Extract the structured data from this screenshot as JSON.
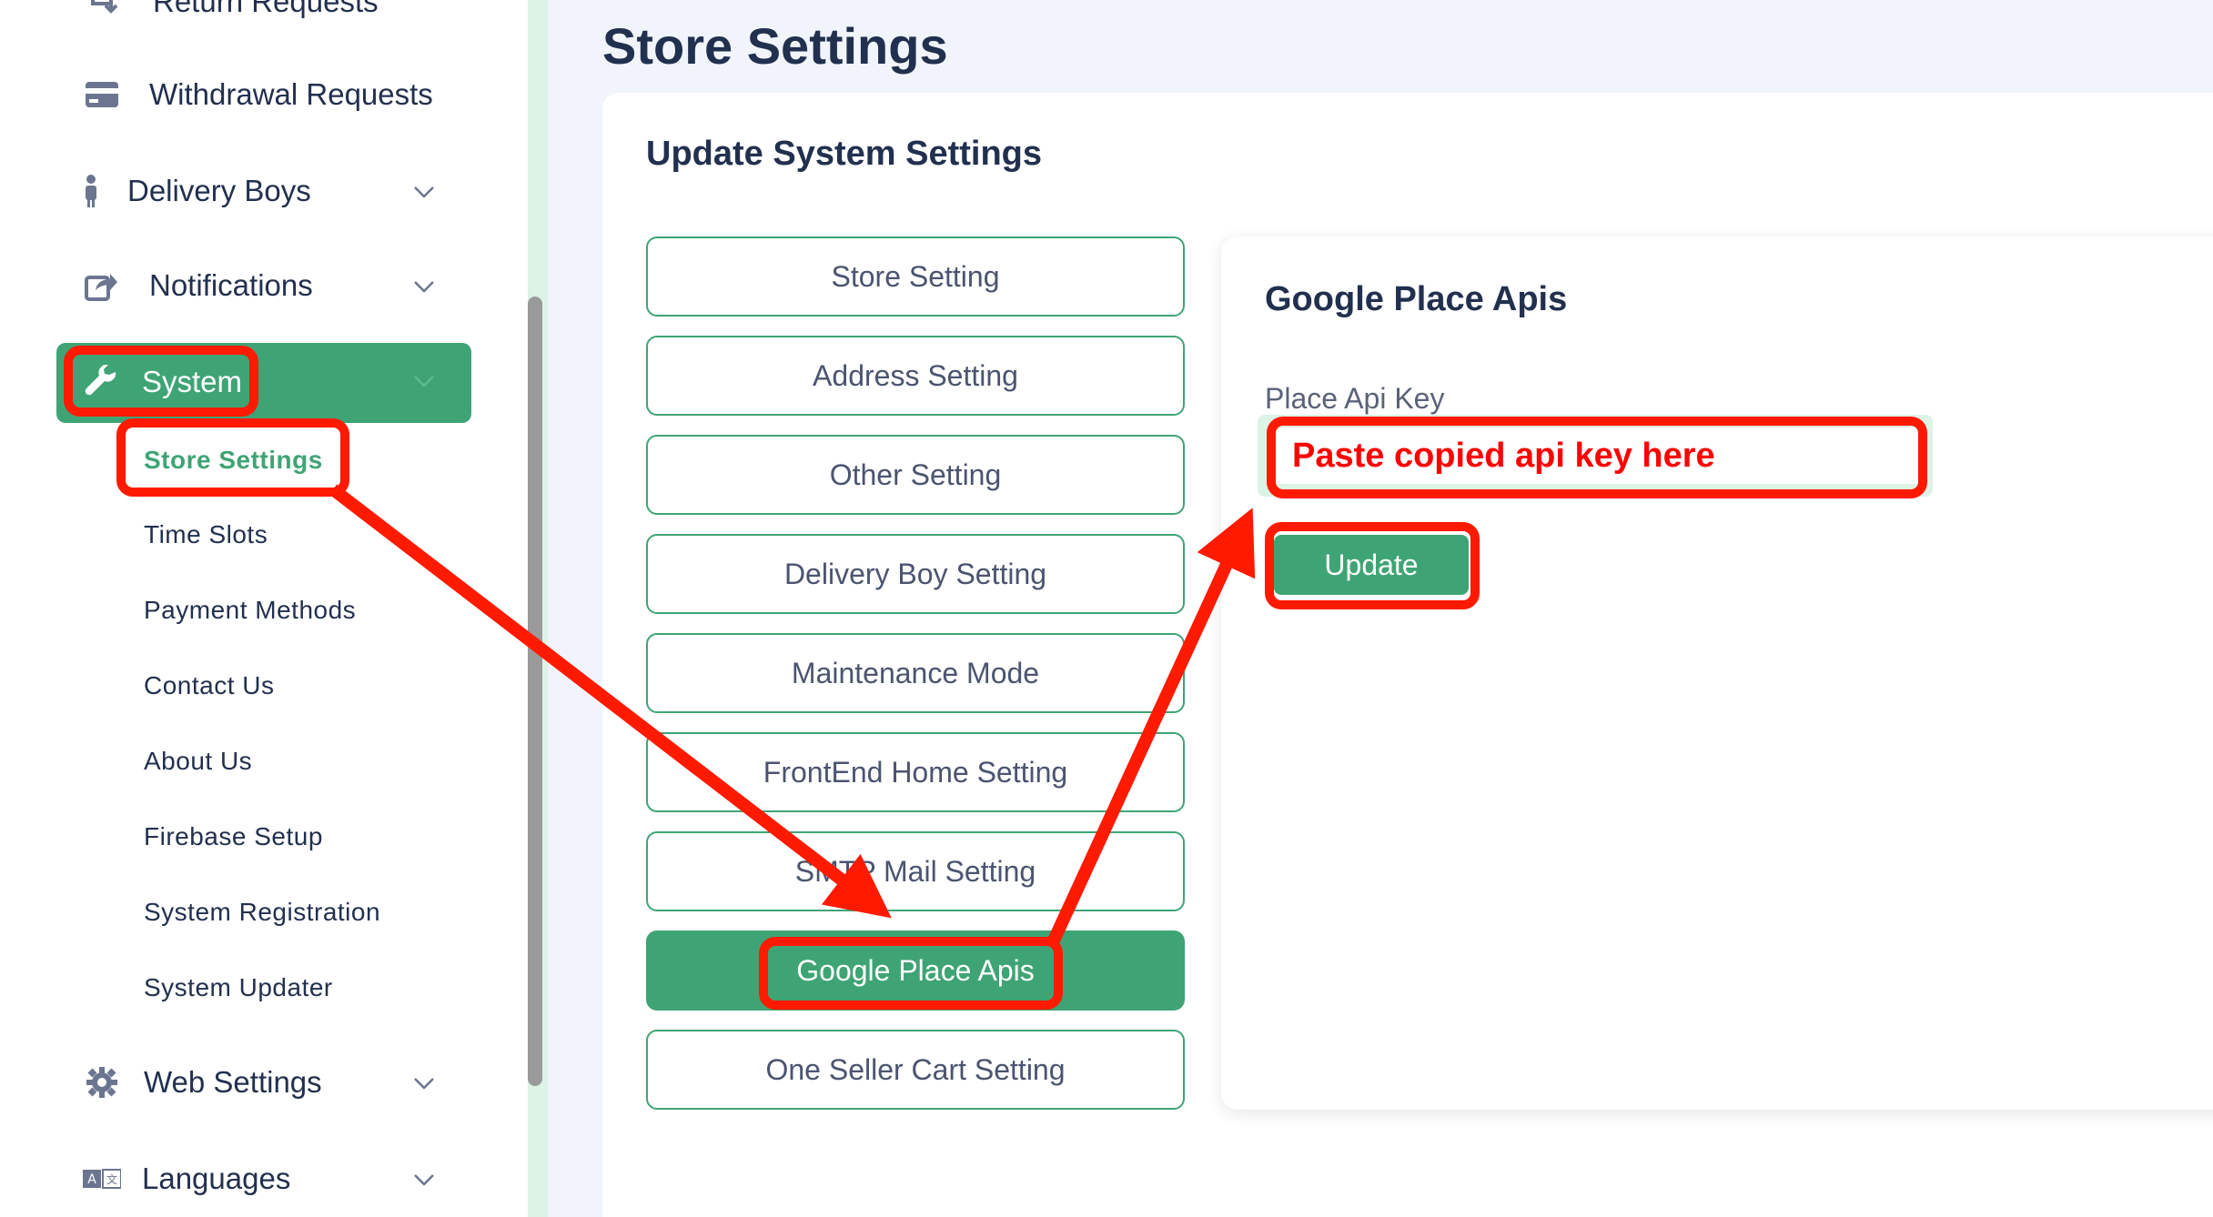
{
  "sidebar": {
    "items": [
      {
        "label": "Return Requests",
        "icon": "return-icon"
      },
      {
        "label": "Withdrawal Requests",
        "icon": "credit-card-icon"
      },
      {
        "label": "Delivery Boys",
        "icon": "person-icon"
      },
      {
        "label": "Notifications",
        "icon": "share-icon"
      },
      {
        "label": "System",
        "icon": "wrench-icon"
      },
      {
        "label": "Web Settings",
        "icon": "gear-icon"
      },
      {
        "label": "Languages",
        "icon": "translate-icon"
      }
    ],
    "system_sub": [
      "Store Settings",
      "Time Slots",
      "Payment Methods",
      "Contact Us",
      "About Us",
      "Firebase Setup",
      "System Registration",
      "System Updater"
    ]
  },
  "page": {
    "title": "Store Settings",
    "card_title": "Update System Settings",
    "tabs": [
      "Store Setting",
      "Address Setting",
      "Other Setting",
      "Delivery Boy Setting",
      "Maintenance Mode",
      "FrontEnd Home Setting",
      "SMTP Mail Setting",
      "Google Place Apis",
      "One Seller Cart Setting"
    ],
    "active_tab": "Google Place Apis"
  },
  "panel": {
    "title": "Google Place Apis",
    "field_label": "Place Api Key",
    "field_value": "Paste copied api key here",
    "update_label": "Update"
  },
  "colors": {
    "accent": "#3fa475",
    "annotation": "#ff1a00",
    "text_dark": "#22304f"
  }
}
